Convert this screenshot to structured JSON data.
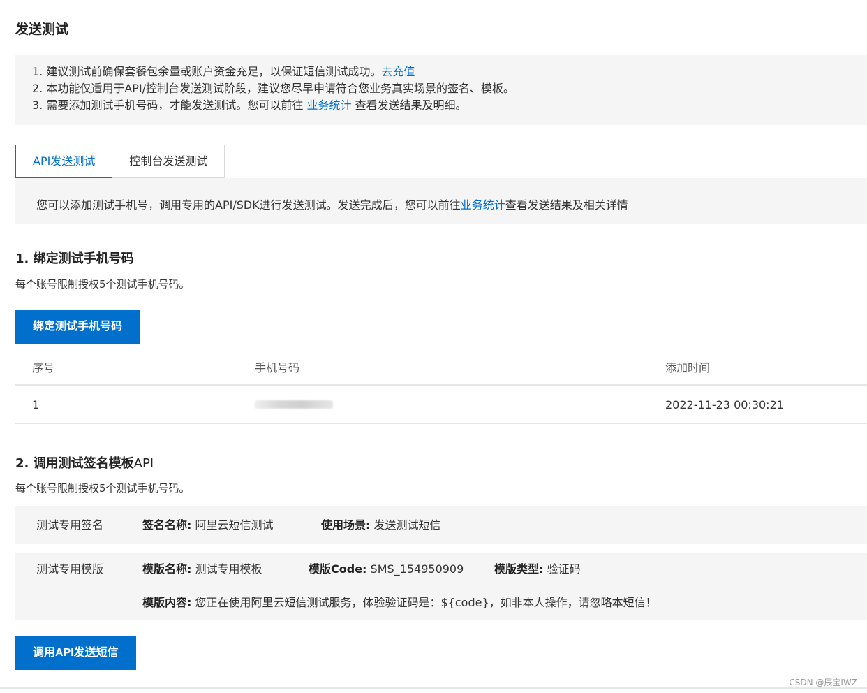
{
  "page": {
    "title": "发送测试"
  },
  "notice": {
    "line1_text": "1. 建议测试前确保套餐包余量或账户资金充足，以保证短信测试成功。",
    "line1_link": "去充值",
    "line2_text": "2. 本功能仅适用于API/控制台发送测试阶段，建议您尽早申请符合您业务真实场景的签名、模板。",
    "line3_text": "3. 需要添加测试手机号码，才能发送测试。您可以前往 ",
    "line3_link": "业务统计",
    "line3_tail": " 查看发送结果及明细。"
  },
  "tabs": [
    {
      "label": "API发送测试",
      "active": true
    },
    {
      "label": "控制台发送测试",
      "active": false
    }
  ],
  "description": {
    "text": "您可以添加测试手机号，调用专用的API/SDK进行发送测试。发送完成后，您可以前往",
    "link": "业务统计",
    "tail": "查看发送结果及相关详情"
  },
  "section1": {
    "title": "1. 绑定测试手机号码",
    "subtitle": "每个账号限制授权5个测试手机号码。",
    "button_label": "绑定测试手机号码"
  },
  "table": {
    "headers": [
      "序号",
      "手机号码",
      "添加时间"
    ],
    "rows": [
      {
        "index": "1",
        "phone": "",
        "added_time": "2022-11-23 00:30:21"
      }
    ]
  },
  "section2": {
    "title_bold": "2. 调用测试签名模板",
    "title_rest": "API",
    "subtitle": "每个账号限制授权5个测试手机号码。",
    "signature": {
      "label": "测试专用签名",
      "name_key": "签名名称:",
      "name_value": "阿里云短信测试",
      "scene_key": "使用场景:",
      "scene_value": "发送测试短信"
    },
    "template": {
      "label": "测试专用模版",
      "name_key": "模版名称:",
      "name_value": "测试专用模板",
      "code_key": "模版Code:",
      "code_value": "SMS_154950909",
      "type_key": "模版类型:",
      "type_value": "验证码",
      "content_key": "模版内容:",
      "content_value": "您正在使用阿里云短信测试服务，体验验证码是：${code}，如非本人操作，请忽略本短信！"
    },
    "button_label": "调用API发送短信"
  },
  "watermark": "CSDN @辰宝IWZ",
  "colors": {
    "primary": "#0070cc",
    "panel_bg": "#f5f5f5",
    "border": "#d9d9d9"
  }
}
